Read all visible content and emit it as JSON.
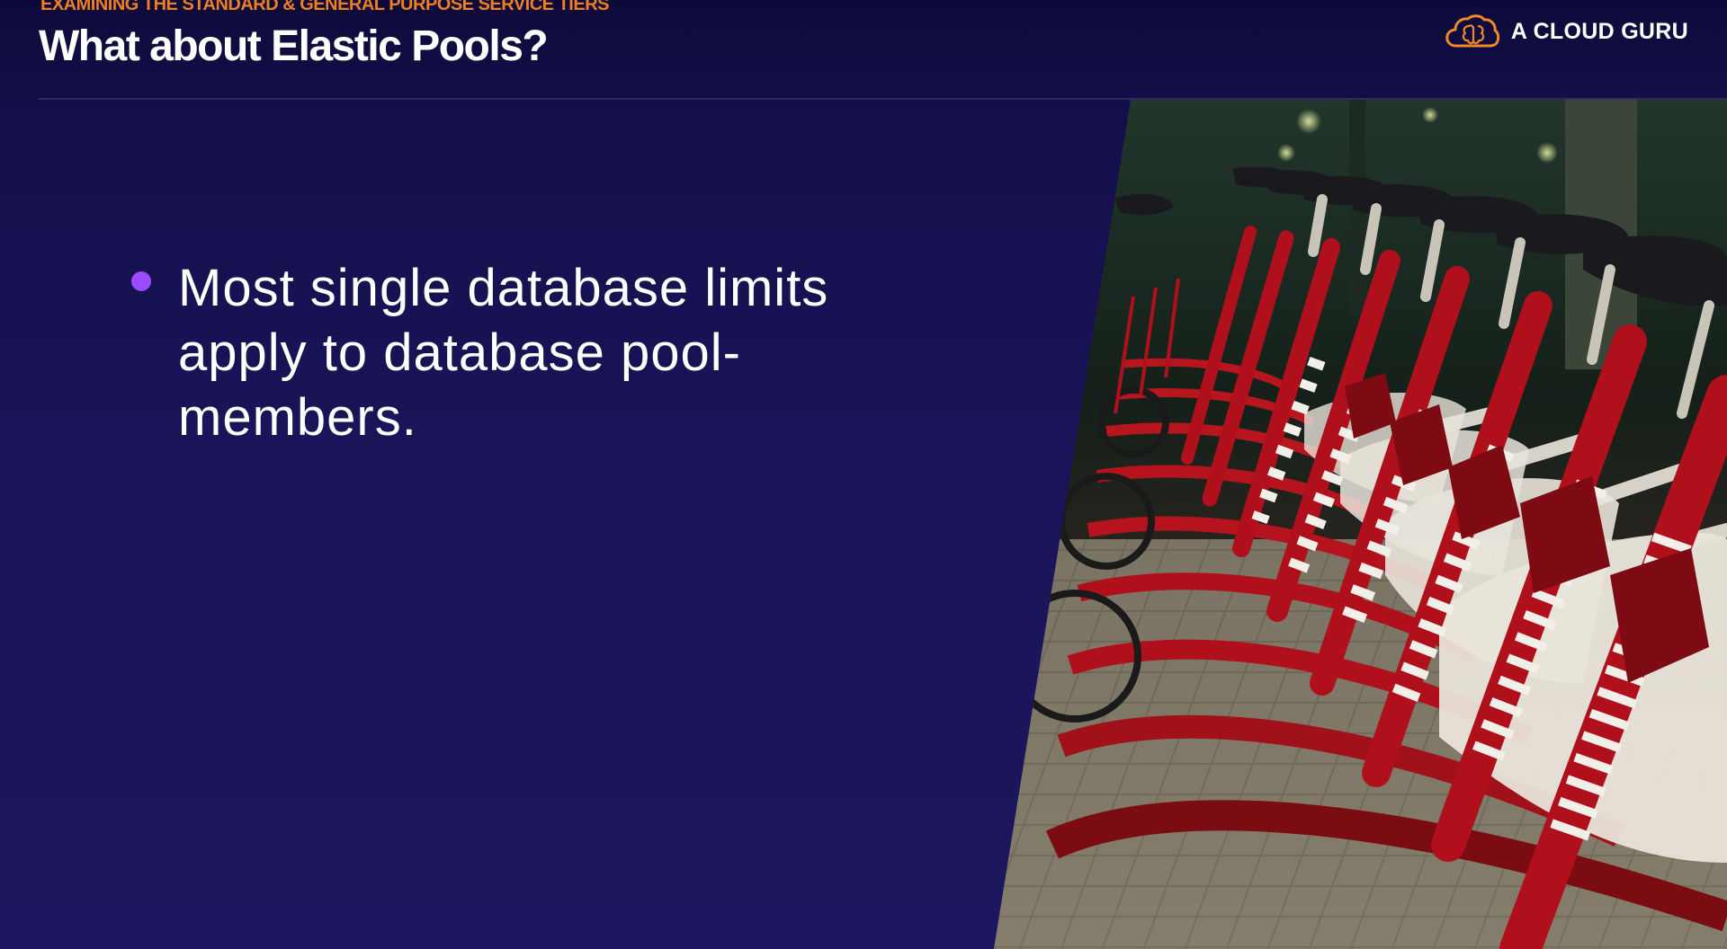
{
  "header": {
    "kicker": "EXAMINING THE STANDARD & GENERAL PURPOSE SERVICE TIERS",
    "title": "What about Elastic Pools?"
  },
  "logo": {
    "text": "A CLOUD GURU",
    "icon": "cloud-brain-icon"
  },
  "content": {
    "bullets": [
      "Most single database limits\napply to database pool-\nmembers."
    ]
  },
  "image": {
    "subject": "row-of-red-rental-bicycles"
  },
  "colors": {
    "kicker": "#ef7f24",
    "bullet": "#9a4bff",
    "logo_mark": "#f08a28",
    "background": "#1a1458",
    "bike_red": "#b0101b"
  }
}
